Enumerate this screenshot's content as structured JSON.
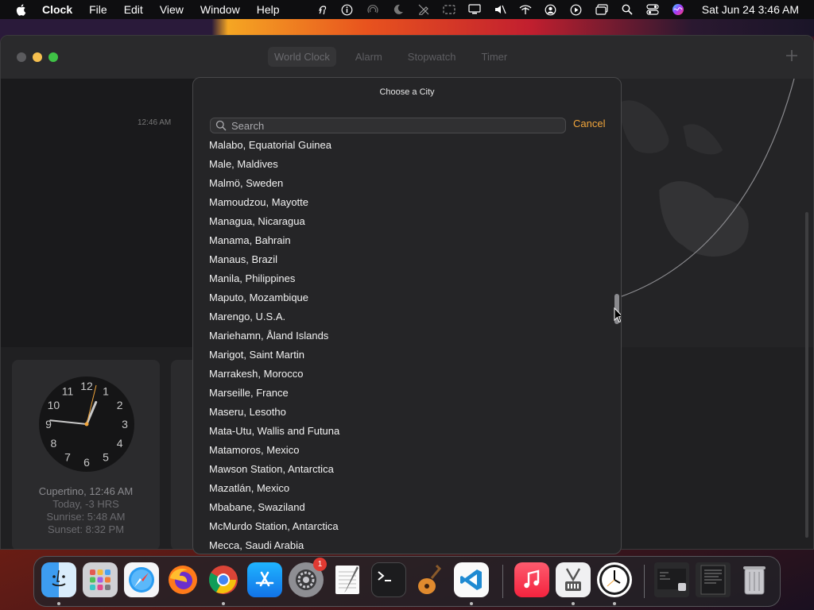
{
  "menubar": {
    "app_name": "Clock",
    "menus": [
      "File",
      "Edit",
      "View",
      "Window",
      "Help"
    ],
    "status_icons": [
      "keychain-icon",
      "info-icon",
      "airdrop-icon",
      "moon-icon",
      "edit-off-icon",
      "screen-icon",
      "display-icon",
      "mute-icon",
      "wifi-icon",
      "user-icon",
      "play-icon",
      "window-icon",
      "search-icon",
      "control-center-icon",
      "siri-icon"
    ],
    "clock": "Sat Jun 24  3:46 AM"
  },
  "window": {
    "tabs": [
      "World Clock",
      "Alarm",
      "Stopwatch",
      "Timer"
    ],
    "active_tab": "World Clock",
    "map_time_label": "12:46 AM"
  },
  "city_card": {
    "city_line": "Cupertino, 12:46 AM",
    "today_line": "Today, -3 HRS",
    "sunrise_line": "Sunrise: 5:48 AM",
    "sunset_line": "Sunset: 8:32 PM",
    "numerals": [
      "12",
      "1",
      "2",
      "3",
      "4",
      "5",
      "6",
      "7",
      "8",
      "9",
      "10",
      "11"
    ],
    "time": "12:46"
  },
  "sheet": {
    "title": "Choose a City",
    "search_placeholder": "Search",
    "cancel_label": "Cancel",
    "cities": [
      "Malabo, Equatorial Guinea",
      "Male, Maldives",
      "Malmö, Sweden",
      "Mamoudzou, Mayotte",
      "Managua, Nicaragua",
      "Manama, Bahrain",
      "Manaus, Brazil",
      "Manila, Philippines",
      "Maputo, Mozambique",
      "Marengo, U.S.A.",
      "Mariehamn, Åland Islands",
      "Marigot, Saint Martin",
      "Marrakesh, Morocco",
      "Marseille, France",
      "Maseru, Lesotho",
      "Mata-Utu, Wallis and Futuna",
      "Matamoros, Mexico",
      "Mawson Station, Antarctica",
      "Mazatlán, Mexico",
      "Mbabane, Swaziland",
      "McMurdo Station, Antarctica",
      "Mecca, Saudi Arabia"
    ]
  },
  "dock": {
    "apps": [
      "Finder",
      "Launchpad",
      "Safari",
      "Firefox",
      "Chrome",
      "App Store",
      "System Settings",
      "TextEdit",
      "Terminal",
      "GarageBand",
      "Visual Studio Code",
      "Music",
      "Instruments",
      "Clock",
      "Window Preview",
      "Document Preview",
      "Trash"
    ],
    "settings_badge": "1"
  }
}
